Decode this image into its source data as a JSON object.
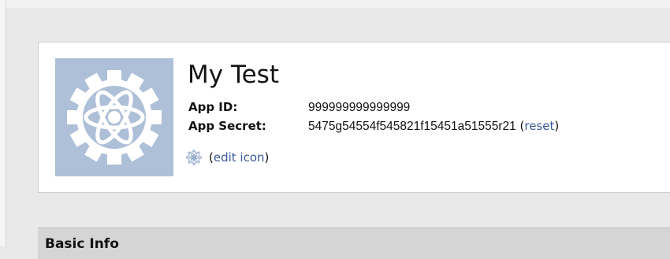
{
  "app": {
    "name": "My Test",
    "app_id_label": "App ID:",
    "app_id_value": "999999999999999",
    "app_secret_label": "App Secret:",
    "app_secret_value": "5475g54554f545821f15451a51555r21",
    "reset_open": "(",
    "reset_label": "reset",
    "reset_close": ")",
    "edit_open": "(",
    "edit_icon_label": "edit icon",
    "edit_close": ")",
    "logo_icon": "atom-gear-icon"
  },
  "sections": {
    "basic_info_title": "Basic Info"
  },
  "colors": {
    "link": "#3b5998",
    "logo_bg": "#aebfd8"
  }
}
